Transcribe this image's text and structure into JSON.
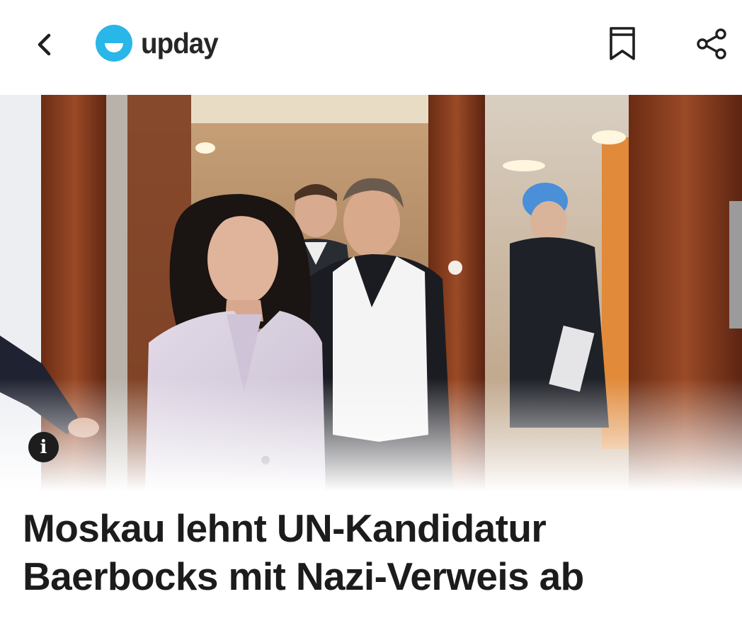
{
  "app_bar": {
    "brand": "upday",
    "back_icon": "chevron-left-icon",
    "bookmark_icon": "bookmark-icon",
    "share_icon": "share-icon",
    "brand_color": "#29b6e8"
  },
  "hero": {
    "image_description_icon": "info-icon",
    "info_glyph": "i"
  },
  "article": {
    "headline": "Moskau lehnt UN-Kandidatur Baerbocks mit Nazi-Verweis ab"
  }
}
